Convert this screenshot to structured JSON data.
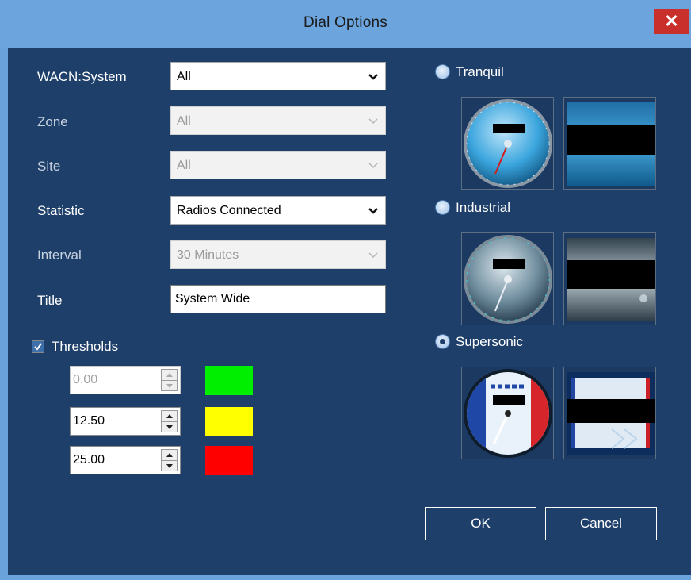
{
  "window": {
    "title": "Dial Options",
    "close_glyph": "✕"
  },
  "form": {
    "wacn": {
      "label": "WACN:System",
      "value": "All"
    },
    "zone": {
      "label": "Zone",
      "value": "All"
    },
    "site": {
      "label": "Site",
      "value": "All"
    },
    "statistic": {
      "label": "Statistic",
      "value": "Radios Connected"
    },
    "interval": {
      "label": "Interval",
      "value": "30 Minutes"
    },
    "title": {
      "label": "Title",
      "value": "System Wide"
    }
  },
  "thresholds": {
    "label": "Thresholds",
    "checked": true,
    "rows": [
      {
        "value": "0.00",
        "color": "#00ee00",
        "enabled": false
      },
      {
        "value": "12.50",
        "color": "#ffff00",
        "enabled": true
      },
      {
        "value": "25.00",
        "color": "#ff0000",
        "enabled": true
      }
    ]
  },
  "styles": {
    "options": [
      {
        "label": "Tranquil",
        "selected": false
      },
      {
        "label": "Industrial",
        "selected": false
      },
      {
        "label": "Supersonic",
        "selected": true
      }
    ]
  },
  "buttons": {
    "ok": "OK",
    "cancel": "Cancel"
  },
  "icons": [
    "close-icon",
    "dropdown-arrow-icon",
    "checkmark-icon",
    "spin-up-icon",
    "spin-down-icon",
    "radio-icon"
  ]
}
